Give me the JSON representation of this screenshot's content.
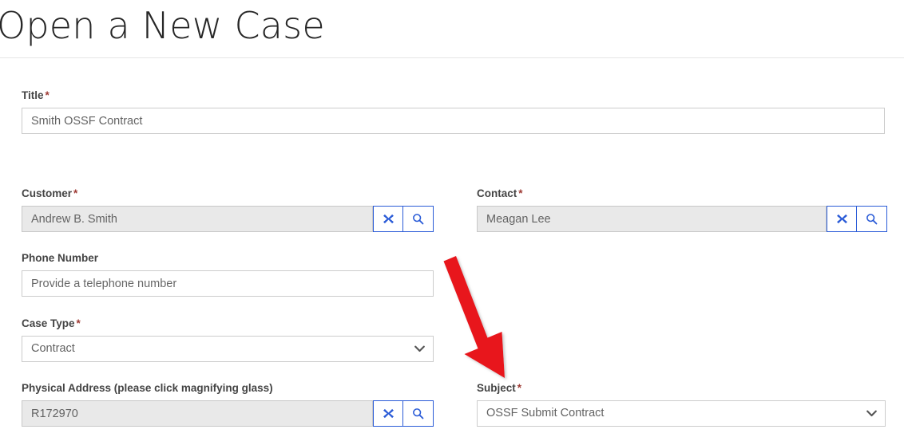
{
  "header": {
    "title": "Open a New Case"
  },
  "form": {
    "fields": [
      {
        "key": "title",
        "label": "Title",
        "required_marker": "*",
        "type": "text",
        "value": "Smith OSSF Contract",
        "placeholder": ""
      },
      {
        "key": "customer",
        "label": "Customer",
        "required_marker": "*",
        "type": "lookup",
        "value": "Andrew B. Smith",
        "placeholder": "",
        "clear_icon": "close-x-icon",
        "search_icon": "magnifying-glass-icon"
      },
      {
        "key": "contact",
        "label": "Contact",
        "required_marker": "*",
        "type": "lookup",
        "value": "Meagan Lee",
        "placeholder": "",
        "clear_icon": "close-x-icon",
        "search_icon": "magnifying-glass-icon"
      },
      {
        "key": "phone",
        "label": "Phone Number",
        "required_marker": "",
        "type": "text",
        "value": "",
        "placeholder": "Provide a telephone number"
      },
      {
        "key": "case_type",
        "label": "Case Type",
        "required_marker": "*",
        "type": "select",
        "value": "Contract",
        "chevron_icon": "chevron-down-icon"
      },
      {
        "key": "physical_address",
        "label": "Physical Address (please click magnifying glass)",
        "required_marker": "",
        "type": "lookup",
        "value": "R172970",
        "placeholder": "",
        "clear_icon": "close-x-icon",
        "search_icon": "magnifying-glass-icon"
      },
      {
        "key": "subject",
        "label": "Subject",
        "required_marker": "*",
        "type": "select",
        "value": "OSSF Submit Contract",
        "chevron_icon": "chevron-down-icon"
      }
    ]
  },
  "annotation": {
    "arrow_icon": "red-arrow-down-right-icon",
    "color": "#E8131F",
    "points_to": "subject"
  },
  "colors": {
    "label_text": "#444444",
    "required_asterisk": "#9E3B34",
    "input_text": "#636363",
    "input_border": "#CCCCCC",
    "readonly_field_bg": "#E9E9E9",
    "lookup_button_accent": "#2A5BD7",
    "title_text": "#262626",
    "annotation_red": "#E8131F"
  }
}
